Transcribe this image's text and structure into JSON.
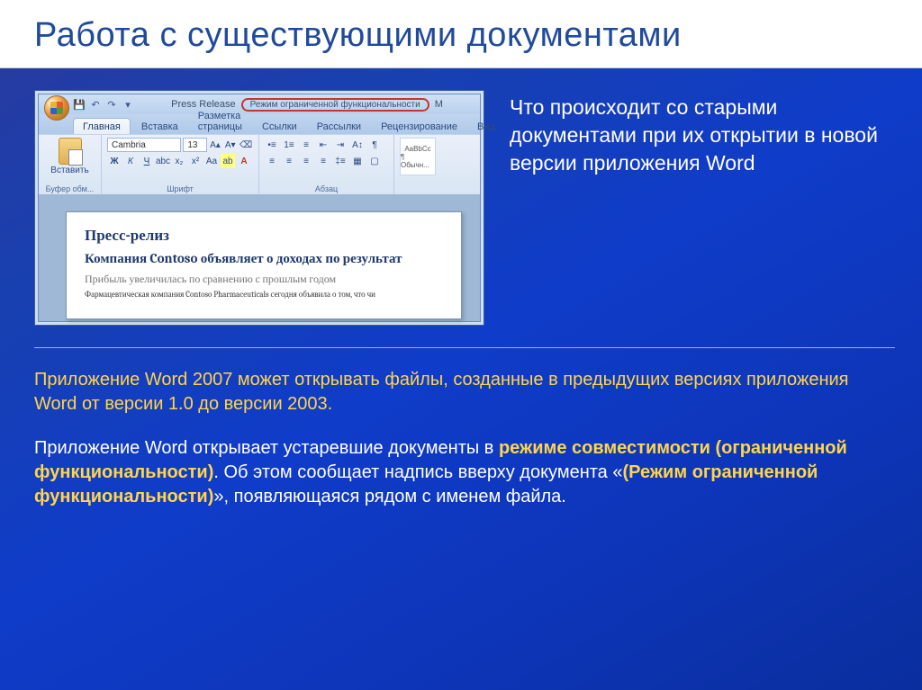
{
  "slide": {
    "title": "Работа с существующими документами"
  },
  "side_caption": "Что происходит со старыми документами при их открытии в новой версии приложения Word",
  "screenshot": {
    "qat_title_left": "Press Release",
    "compat_badge": "Режим ограниченной функциональности",
    "qat_title_right": "M",
    "tabs": [
      "Главная",
      "Вставка",
      "Разметка страницы",
      "Ссылки",
      "Рассылки",
      "Рецензирование",
      "Вид"
    ],
    "clipboard": {
      "paste": "Вставить",
      "label": "Буфер обм..."
    },
    "font": {
      "name": "Cambria",
      "size": "13",
      "label": "Шрифт"
    },
    "paragraph": {
      "label": "Абзац"
    },
    "styles": {
      "sample": "AaBbCc",
      "normal": "¶ Обычн..."
    },
    "doc": {
      "h1": "Пресс-релиз",
      "h2": "Компания Contoso объявляет о доходах по результат",
      "h3": "Прибыль увеличилась по сравнению с прошлым годом",
      "p": "Фармацевтическая компания Contoso Pharmaceuticals сегодня объявила о том, что чи"
    }
  },
  "body": {
    "p1a": "Приложение Word 2007 может открывать файлы, созданные в предыдущих версиях приложения Word от версии 1.0 до версии 2003.",
    "p2a": "Приложение Word открывает устаревшие документы в ",
    "p2b": "режиме совместимости (ограниченной функциональности)",
    "p2c": ". Об этом сообщает надпись вверху документа «",
    "p2d": "(Режим ограниченной функциональности)",
    "p2e": "», появляющаяся рядом с именем файла."
  }
}
